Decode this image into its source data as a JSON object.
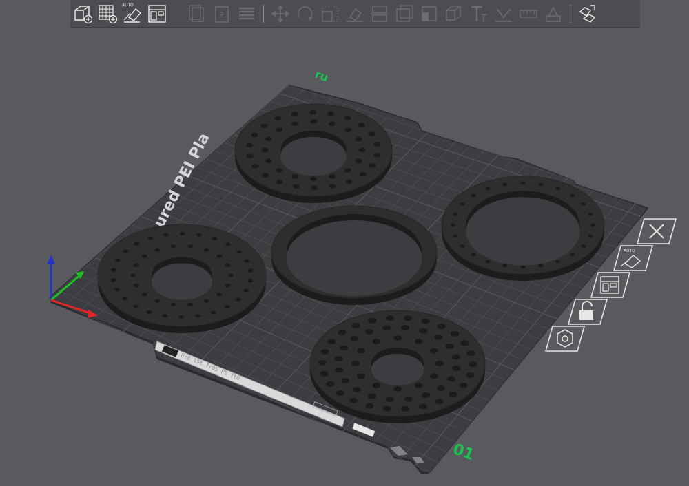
{
  "app": {
    "name": "3D printer slicer plater view"
  },
  "toolbar": {
    "auto_label": "AUTO",
    "buttons": [
      {
        "name": "add-object",
        "enabled": true
      },
      {
        "name": "add-instances",
        "enabled": true
      },
      {
        "name": "auto-arrange",
        "enabled": true
      },
      {
        "name": "layout-view",
        "enabled": true
      },
      {
        "name": "copy",
        "enabled": false
      },
      {
        "name": "paste",
        "enabled": false
      },
      {
        "name": "layers",
        "enabled": false
      },
      {
        "name": "move",
        "enabled": false
      },
      {
        "name": "rotate",
        "enabled": false
      },
      {
        "name": "scale",
        "enabled": false
      },
      {
        "name": "place-on-face",
        "enabled": false
      },
      {
        "name": "cut",
        "enabled": false
      },
      {
        "name": "hollow",
        "enabled": false
      },
      {
        "name": "seam",
        "enabled": false
      },
      {
        "name": "support-paint",
        "enabled": false
      },
      {
        "name": "text",
        "enabled": false
      },
      {
        "name": "measure",
        "enabled": false
      },
      {
        "name": "ruler",
        "enabled": false
      },
      {
        "name": "assemble",
        "enabled": false
      },
      {
        "name": "split-view",
        "enabled": true
      }
    ]
  },
  "bed": {
    "label_text": "ured PEI Pla",
    "plate_number": "01",
    "plate_mark": "ru",
    "sticker_text": "8:8 lSt fr0S PE ft0"
  },
  "plate_controls": {
    "auto_label": "AUTO",
    "items": [
      "close-plate",
      "auto-arrange-plate",
      "plate-layout",
      "lock-plate",
      "plate-settings"
    ]
  },
  "colors": {
    "background": "#595a5e",
    "toolbar": "#4b4d51",
    "bed": "#3c3d41",
    "grid": "#535459",
    "part": "#2e2e2f",
    "part_side": "#1c1c1d",
    "accent_green": "#19c34d",
    "axis_x": "#e02626",
    "axis_y": "#1fc11f",
    "axis_z": "#2731c8"
  },
  "objects": [
    {
      "name": "disc-back",
      "style": "plate-with-holes"
    },
    {
      "name": "ring-right",
      "style": "ring-with-holes"
    },
    {
      "name": "ring-center",
      "style": "plain-ring"
    },
    {
      "name": "disc-left",
      "style": "plate-with-holes"
    },
    {
      "name": "disc-front",
      "style": "plate-with-holes-dense"
    }
  ]
}
